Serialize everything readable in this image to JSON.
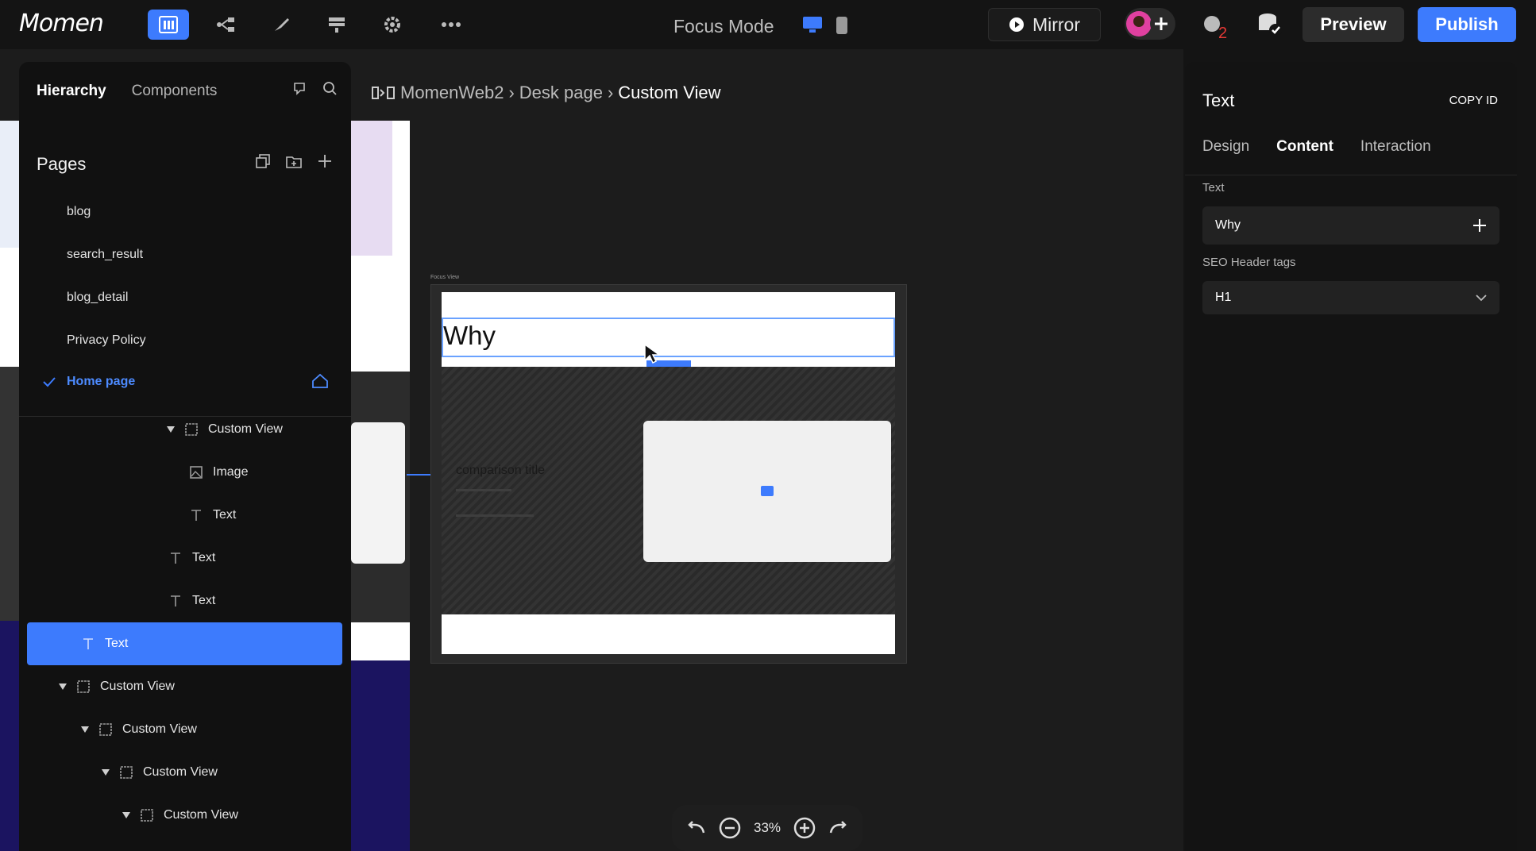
{
  "topbar": {
    "logo": "Momen",
    "focus_mode": "Focus Mode",
    "mirror": "Mirror",
    "preview": "Preview",
    "publish": "Publish",
    "notification_count": "2"
  },
  "left_panel": {
    "tabs": [
      "Hierarchy",
      "Components"
    ],
    "pages_title": "Pages",
    "pages": [
      "blog",
      "search_result",
      "blog_detail",
      "Privacy Policy"
    ],
    "home_page": "Home page",
    "tree": [
      {
        "label": "Custom View",
        "icon": "frame-icon"
      },
      {
        "label": "Image",
        "icon": "image-icon"
      },
      {
        "label": "Text",
        "icon": "text-icon"
      },
      {
        "label": "Text",
        "icon": "text-icon"
      },
      {
        "label": "Text",
        "icon": "text-icon"
      },
      {
        "label": "Text",
        "icon": "text-icon",
        "selected": true
      },
      {
        "label": "Custom View",
        "icon": "frame-icon"
      },
      {
        "label": "Custom View",
        "icon": "frame-icon"
      },
      {
        "label": "Custom View",
        "icon": "frame-icon"
      },
      {
        "label": "Custom View",
        "icon": "frame-icon"
      }
    ]
  },
  "breadcrumb": [
    "MomenWeb2",
    "Desk page",
    "Custom View"
  ],
  "canvas": {
    "focus_view_label": "Focus View",
    "heading_text": "Why",
    "comparison_title": "comparison title",
    "zoom": "33%"
  },
  "right_panel": {
    "title": "Text",
    "copy_id": "COPY ID",
    "tabs": [
      "Design",
      "Content",
      "Interaction"
    ],
    "active_tab": "Content",
    "text_label": "Text",
    "text_value": "Why",
    "seo_label": "SEO Header tags",
    "seo_value": "H1"
  },
  "colors": {
    "accent": "#3d7bfd",
    "background": "#141414",
    "panel": "#111111"
  }
}
